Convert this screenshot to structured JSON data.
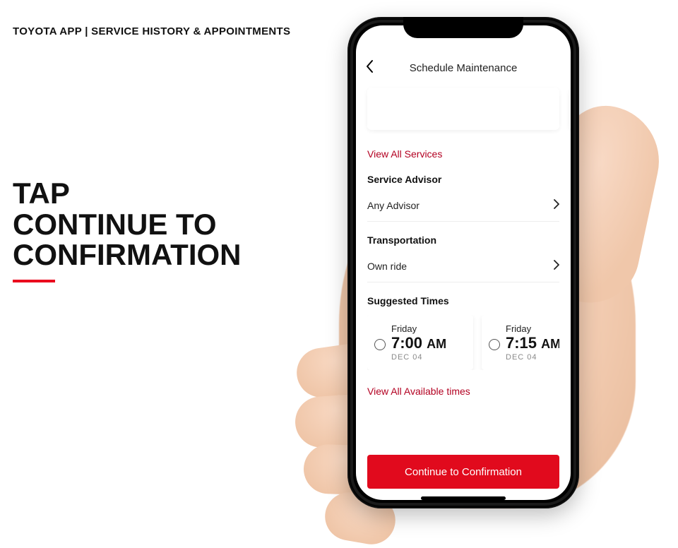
{
  "page": {
    "header": "TOYOTA APP | SERVICE HISTORY & APPOINTMENTS",
    "headline_line1": "TAP",
    "headline_line2": "CONTINUE TO",
    "headline_line3": "CONFIRMATION"
  },
  "colors": {
    "brand_red": "#e10a1d",
    "link_red": "#b30021"
  },
  "app": {
    "title": "Schedule Maintenance",
    "view_all_services": "View All Services",
    "sections": {
      "advisor": {
        "title": "Service Advisor",
        "value": "Any Advisor"
      },
      "transportation": {
        "title": "Transportation",
        "value": "Own ride"
      },
      "suggested": {
        "title": "Suggested Times",
        "times": [
          {
            "day": "Friday",
            "hour": "7:00",
            "ampm": "AM",
            "date": "DEC  04"
          },
          {
            "day": "Friday",
            "hour": "7:15",
            "ampm": "AM",
            "date": "DEC  04"
          }
        ]
      }
    },
    "view_all_times": "View All Available times",
    "cta": "Continue to Confirmation"
  }
}
